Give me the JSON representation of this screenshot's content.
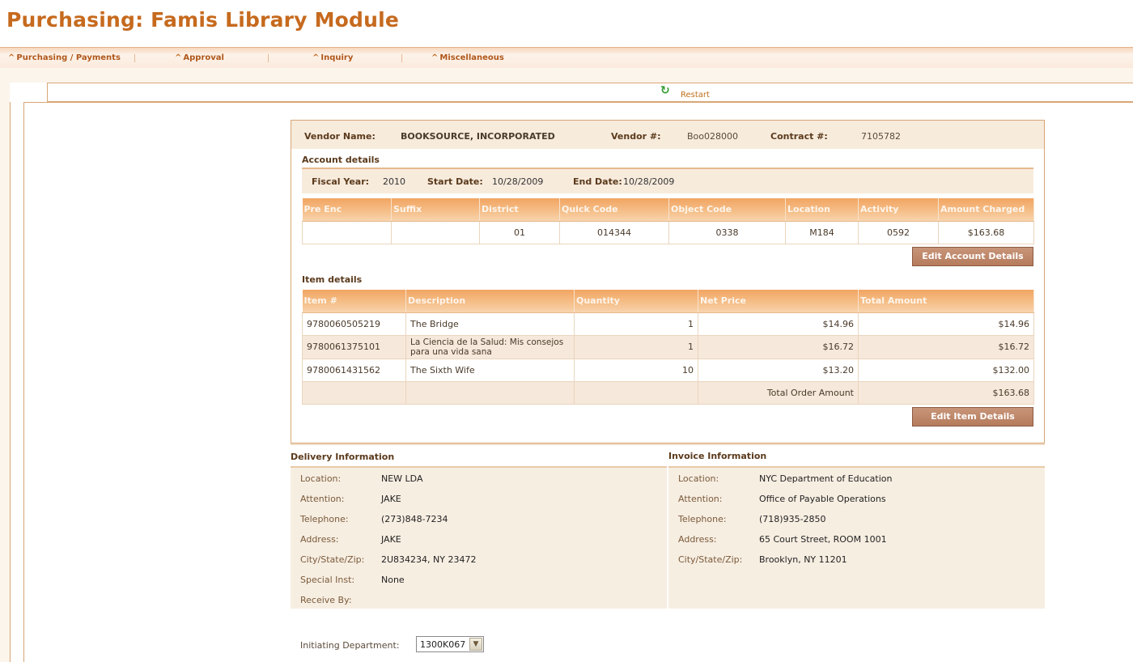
{
  "app": {
    "title": "Purchasing: Famis Library Module"
  },
  "nav": {
    "items": [
      {
        "label": "Purchasing / Payments"
      },
      {
        "label": "Approval"
      },
      {
        "label": "Inquiry"
      },
      {
        "label": "Miscellaneous"
      }
    ]
  },
  "toolbar": {
    "restart_label": "Restart",
    "restart_icon": "refresh-icon"
  },
  "vendor": {
    "name_label": "Vendor Name:",
    "name": "BOOKSOURCE, INCORPORATED",
    "number_label": "Vendor #:",
    "number": "Boo028000",
    "contract_label": "Contract #:",
    "contract": "7105782"
  },
  "account": {
    "heading": "Account details",
    "fiscal_year_label": "Fiscal Year:",
    "fiscal_year": "2010",
    "start_date_label": "Start Date:",
    "start_date": "10/28/2009",
    "end_date_label": "End Date:",
    "end_date": "10/28/2009",
    "columns": [
      "Pre Enc",
      "Suffix",
      "District",
      "Quick Code",
      "Object Code",
      "Location",
      "Activity",
      "Amount Charged"
    ],
    "row": [
      "",
      "",
      "01",
      "014344",
      "0338",
      "M184",
      "0592",
      "$163.68"
    ],
    "edit_button": "Edit Account Details"
  },
  "items": {
    "heading": "Item details",
    "columns": [
      "Item #",
      "Description",
      "Quantity",
      "Net Price",
      "Total Amount"
    ],
    "rows": [
      {
        "item": "9780060505219",
        "description": "The Bridge",
        "quantity": "1",
        "net_price": "$14.96",
        "total": "$14.96"
      },
      {
        "item": "9780061375101",
        "description": "La Ciencia de la Salud: Mis consejos para una vida sana",
        "quantity": "1",
        "net_price": "$16.72",
        "total": "$16.72"
      },
      {
        "item": "9780061431562",
        "description": "The Sixth Wife",
        "quantity": "10",
        "net_price": "$13.20",
        "total": "$132.00"
      }
    ],
    "total_label": "Total Order Amount",
    "total_value": "$163.68",
    "edit_button": "Edit Item Details"
  },
  "delivery": {
    "title": "Delivery Information",
    "fields": [
      {
        "label": "Location:",
        "value": "NEW LDA"
      },
      {
        "label": "Attention:",
        "value": "JAKE"
      },
      {
        "label": "Telephone:",
        "value": "(273)848-7234"
      },
      {
        "label": "Address:",
        "value": "JAKE"
      },
      {
        "label": "City/State/Zip:",
        "value": "2U834234, NY 23472"
      },
      {
        "label": "Special Inst:",
        "value": "None"
      },
      {
        "label": "Receive By:",
        "value": ""
      }
    ]
  },
  "invoice": {
    "title": "Invoice Information",
    "fields": [
      {
        "label": "Location:",
        "value": "NYC Department of Education"
      },
      {
        "label": "Attention:",
        "value": "Office of Payable Operations"
      },
      {
        "label": "Telephone:",
        "value": "(718)935-2850"
      },
      {
        "label": "Address:",
        "value": "65 Court Street, ROOM 1001"
      },
      {
        "label": "City/State/Zip:",
        "value": "Brooklyn, NY 11201"
      }
    ]
  },
  "initiating": {
    "label": "Initiating Department:",
    "selected": "1300K067"
  },
  "colors": {
    "brand": "#c66a1e",
    "header_orange": "#f2a563",
    "button_brown": "#b57b5c",
    "panel_bg": "#f7ebdc"
  }
}
